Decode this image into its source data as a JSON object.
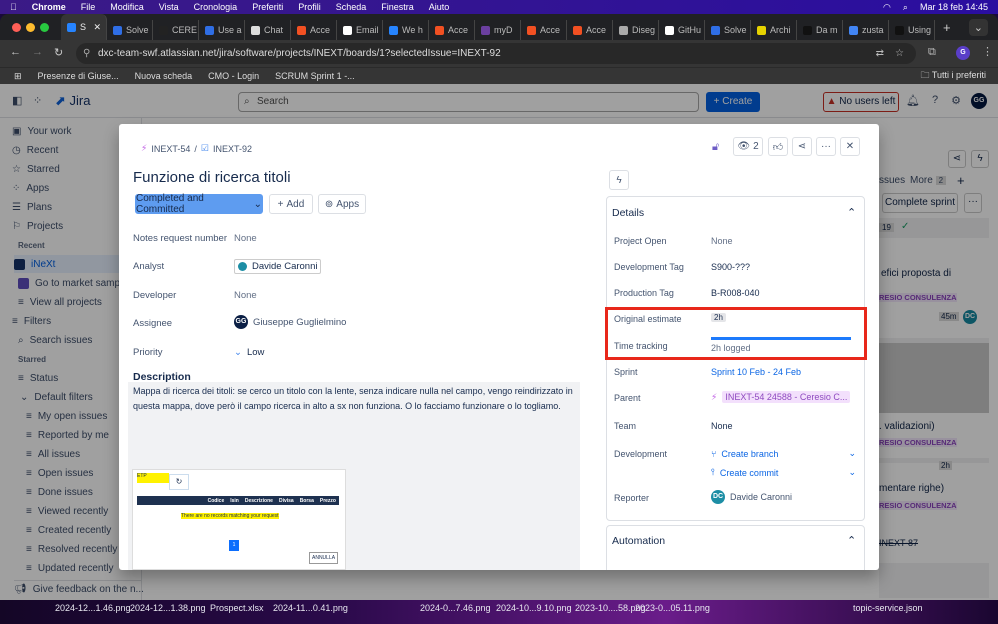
{
  "macos_menu": {
    "app": "Chrome",
    "items": [
      "File",
      "Modifica",
      "Vista",
      "Cronologia",
      "Preferiti",
      "Profili",
      "Scheda",
      "Finestra",
      "Aiuto"
    ],
    "clock": "Mar 18 feb  14:45"
  },
  "browser": {
    "tabs": [
      {
        "label": "S",
        "active": true,
        "color": "#2684ff"
      },
      {
        "label": "Solve",
        "color": "#2f6ee6"
      },
      {
        "label": "CERE",
        "color": "#222222"
      },
      {
        "label": "Use a",
        "color": "#2f6ee6"
      },
      {
        "label": "Chat",
        "color": "#dddddd"
      },
      {
        "label": "Acce",
        "color": "#f25022"
      },
      {
        "label": "Email",
        "color": "#ffffff"
      },
      {
        "label": "We h",
        "color": "#2684ff"
      },
      {
        "label": "Acce",
        "color": "#f25022"
      },
      {
        "label": "myD",
        "color": "#6b3fa0"
      },
      {
        "label": "Acce",
        "color": "#f25022"
      },
      {
        "label": "Acce",
        "color": "#f25022"
      },
      {
        "label": "Diseg",
        "color": "#aaaaaa"
      },
      {
        "label": "GitHu",
        "color": "#ffffff"
      },
      {
        "label": "Solve",
        "color": "#2f6ee6"
      },
      {
        "label": "Archi",
        "color": "#e6d200"
      },
      {
        "label": "Da m",
        "color": "#111111"
      },
      {
        "label": "zusta",
        "color": "#4285f4"
      },
      {
        "label": "Using",
        "color": "#111111"
      }
    ],
    "url": "dxc-team-swf.atlassian.net/jira/software/projects/INEXT/boards/1?selectedIssue=INEXT-92",
    "profile_initial": "G",
    "bookmarks": [
      "Presenze di Giuse...",
      "Nuova scheda",
      "CMO - Login",
      "SCRUM Sprint 1 -..."
    ],
    "all_bookmarks": "Tutti i preferiti"
  },
  "jira": {
    "logo": "Jira",
    "search_placeholder": "Search",
    "create": "+ Create",
    "no_users": "No users left",
    "user_initials": "GG",
    "sidebar": {
      "items": [
        "Your work",
        "Recent",
        "Starred",
        "Apps",
        "Plans",
        "Projects"
      ],
      "recent_heading": "Recent",
      "projects": [
        "iNeXt",
        "Go to market sample",
        "View all projects"
      ],
      "filters": "Filters",
      "search_issues": "Search issues",
      "starred_heading": "Starred",
      "status": "Status",
      "default_filters": "Default filters",
      "filter_items": [
        "My open issues",
        "Reported by me",
        "All issues",
        "Open issues",
        "Done issues",
        "Viewed recently",
        "Created recently",
        "Resolved recently",
        "Updated recently"
      ],
      "feedback": "Give feedback on the n..."
    },
    "board": {
      "tabs_partial": "ssues",
      "more": "More",
      "more_count": "2",
      "complete_sprint": "Complete sprint",
      "count": "19",
      "card1_title": "efici proposta di",
      "epic_label": "RESIO CONSULENZA",
      "card1_time": "45m",
      "card2_title": ". validazioni)",
      "card2_time": "2h",
      "card3_title": "mentare righe)",
      "card3_key": "INEXT-87",
      "assignee": "DC"
    }
  },
  "issue": {
    "parent_key": "INEXT-54",
    "key": "INEXT-92",
    "watchers": "2",
    "title": "Funzione di ricerca titoli",
    "status": "Completed and Committed",
    "add": "Add",
    "apps": "Apps",
    "fields": [
      {
        "label": "Notes request number",
        "value": "None"
      },
      {
        "label": "Analyst",
        "value": "Davide Caronni"
      },
      {
        "label": "Developer",
        "value": "None"
      },
      {
        "label": "Assignee",
        "value": "Giuseppe Guglielmino",
        "initials": "GG"
      },
      {
        "label": "Priority",
        "value": "Low"
      }
    ],
    "description_heading": "Description",
    "description": "Mappa di ricerca dei titoli: se cerco un titolo con la lente, senza indicare nulla nel campo, vengo reindirizzato in questa mappa, dove però il campo ricerca in alto a sx non funziona. O lo facciamo funzionare o lo togliamo.",
    "screenshot": {
      "input_value": "ETP",
      "columns": [
        "Codice",
        "Isin",
        "Descrizione",
        "Divisa",
        "Borsa",
        "Prezzo"
      ],
      "empty_message": "There are no records matching your request",
      "page": "1",
      "cancel": "ANNULLA"
    },
    "details": {
      "heading": "Details",
      "project_open": {
        "label": "Project Open",
        "value": "None"
      },
      "dev_tag": {
        "label": "Development Tag",
        "value": "S900-???"
      },
      "prod_tag": {
        "label": "Production Tag",
        "value": "B-R008-040"
      },
      "original_estimate": {
        "label": "Original estimate",
        "value": "2h"
      },
      "time_tracking": {
        "label": "Time tracking",
        "value": "2h logged",
        "progress": 1.0
      },
      "sprint": {
        "label": "Sprint",
        "value": "Sprint 10 Feb - 24 Feb"
      },
      "parent": {
        "label": "Parent",
        "value": "INEXT-54 24588 - Ceresio C..."
      },
      "team": {
        "label": "Team",
        "value": "None"
      },
      "development": {
        "label": "Development",
        "branch": "Create branch",
        "commit": "Create commit"
      },
      "reporter": {
        "label": "Reporter",
        "value": "Davide Caronni",
        "initials": "DC"
      }
    },
    "automation": "Automation",
    "highlight_color": "#e8271a"
  },
  "dock_files": [
    "2024-12...1.46.png",
    "2024-12...1.38.png",
    "Prospect.xlsx",
    "2024-11...0.41.png",
    "2024-0...7.46.png",
    "2024-10...9.10.png",
    "2023-10....58.png",
    "2023-0...05.11.png",
    "topic-service.json"
  ]
}
